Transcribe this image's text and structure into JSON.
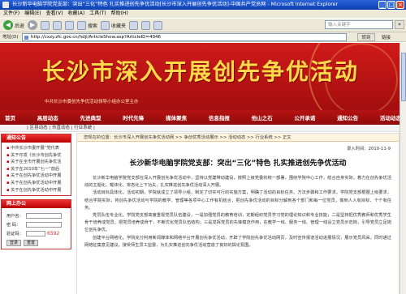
{
  "window": {
    "title": "长沙新华电脑学院党支部：突出“三化”特色 扎实推进创先争优活动[长沙市深入开展创先争优活动]-中国共产党员网 - Microsoft Internet Explorer"
  },
  "menu": [
    "文件(F)",
    "编辑(E)",
    "查看(V)",
    "收藏(A)",
    "工具(T)",
    "帮助(H)"
  ],
  "toolbar": {
    "back_label": "后退",
    "forward_label": "",
    "search_label": "搜索",
    "favorites_label": "收藏夹",
    "search_placeholder": "输入关键字",
    "search_go": "»"
  },
  "address": {
    "label": "地址(D)",
    "url": "http://cxzy.zfc.gov.cn/hdjl/ArticleShow.asp?ArticleID=4046",
    "go_label": "转到",
    "links_label": "链接"
  },
  "banner": {
    "title": "长沙市深入开展创先争优活动",
    "subtitle": "中共长沙市委创先争优活动领导小组办公室主办"
  },
  "nav": [
    "首页",
    "高层动态",
    "先进典型",
    "时代先锋",
    "媒体聚焦",
    "信息指报",
    "他山之石",
    "公开承诺",
    "通知公告",
    "活动动态"
  ],
  "subnav": "| 区县动态 | 市直动态 | 行业系统 |",
  "sidebar": {
    "notice_title": "通知公告",
    "notices": [
      "中共长沙市委开展“党代表",
      "关于印发《长沙市创先争优",
      "关于在全市开展创先争优活",
      "关于在2010年“七一”前后",
      "关于在创先争优活动中开展",
      "关于在创先争优活动中开展",
      "关于在创先争优活动中开展"
    ],
    "login_title": "网上办公",
    "user_label": "用户名：",
    "password_label": "密  码：",
    "code_label": "验证码：",
    "code_value": "6592",
    "login_btn": "登录",
    "reset_btn": "重置"
  },
  "article": {
    "breadcrumb": "您现在的位置：长沙市深入开展创先争优活动网 >> 争创优秀活动展示 >> 活动动态 >> 行业系统 >> 正文",
    "pub_time": "录入时间：2010-11-9",
    "headline": "长沙新华电脑学院党支部：突出“三化”特色  扎实推进创先争优活动",
    "paragraphs": [
      "长沙新华电脑学院党支部在深入开展创先争优活动中，坚持以党建带动建设，按照上级党委的统一部署，围绕学院中心工作，结合自身实际，着力在创先争优活动的主题化、载体化、常态化上下功夫，扎实推进创先争优活动深入开展。",
      "活动目标具体化。活动初期，学院就成立了领导小组，制定了切实可行的实施方案，明确了活动的目标任务、方法步骤和工作要求。学院党支部根据上级要求，结合学院实际，将创先争优活动与学院的教学、管理等各项中心工作有机结合，把创先争优活动的目标分解到各个部门和每一位党员，做到人人有目标、个个有任务。",
      "党员队伍专业化。学院党支部高度重视党员队伍建设，一是加强党员的教育培训，定期组织党员学习党的理论知识和专业技能；二是坚持把优秀教师和优秀学生骨干培养成党员，把党员培养成骨干，不断优化党员队伍结构；三是发挥党员的先锋模范作用，在教学一线、服务一线、管理一线设立党员示范岗，引导党员立足岗位创先争优。",
      "创建平台网络化。学院充分利用新闻媒体和网络平台开展创先争优活动，开辟了学院创先争优活动网页，及时宣传报道活动进展情况，展示党员风采，同时通过网络征集意见建议，接受师生员工监督，为扎实推进创先争优活动营造了良好的舆论氛围。"
    ]
  }
}
